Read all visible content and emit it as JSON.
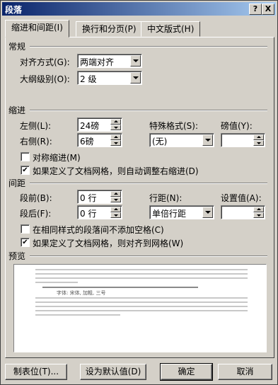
{
  "window": {
    "title": "段落"
  },
  "titlebar_buttons": {
    "help": "?",
    "close": "X"
  },
  "tabs": [
    {
      "label": "缩进和间距(I)"
    },
    {
      "label": "换行和分页(P)"
    },
    {
      "label": "中文版式(H)"
    }
  ],
  "general": {
    "heading": "常规",
    "alignment_label": "对齐方式(G):",
    "alignment_value": "两端对齐",
    "outline_label": "大纲级别(O):",
    "outline_value": "2 级"
  },
  "indent": {
    "heading": "缩进",
    "left_label": "左侧(L):",
    "left_value": "24磅",
    "right_label": "右侧(R):",
    "right_value": "6磅",
    "special_label": "特殊格式(S):",
    "special_value": "(无)",
    "by_label": "磅值(Y):",
    "by_value": "",
    "mirror_label": "对称缩进(M)",
    "mirror_checked": false,
    "auto_right_label": "如果定义了文档网格，则自动调整右缩进(D)",
    "auto_right_checked": true
  },
  "spacing": {
    "heading": "间距",
    "before_label": "段前(B):",
    "before_value": "0 行",
    "after_label": "段后(F):",
    "after_value": "0 行",
    "line_label": "行距(N):",
    "line_value": "单倍行距",
    "at_label": "设置值(A):",
    "at_value": "",
    "no_space_label": "在相同样式的段落间不添加空格(C)",
    "no_space_checked": false,
    "snap_grid_label": "如果定义了文档网格，则对齐到网格(W)",
    "snap_grid_checked": true
  },
  "preview": {
    "heading": "预览",
    "sample": "字体: 宋体, 加粗, 三号"
  },
  "buttons": {
    "tabs": "制表位(T)...",
    "default": "设为默认值(D)",
    "ok": "确定",
    "cancel": "取消"
  }
}
